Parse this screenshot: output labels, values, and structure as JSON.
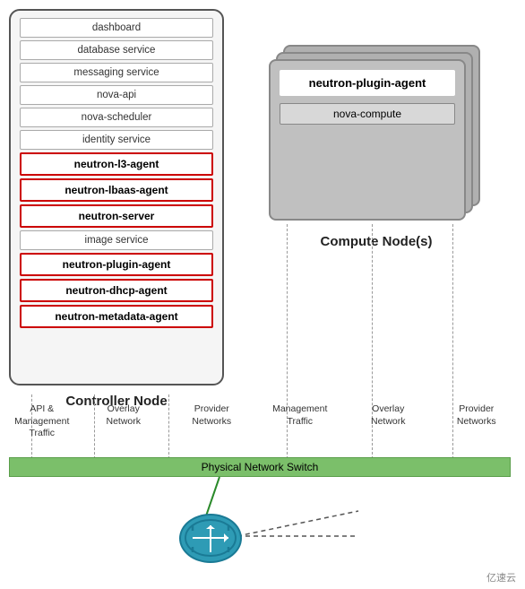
{
  "controller": {
    "label": "Controller Node",
    "services": [
      {
        "id": "dashboard",
        "text": "dashboard",
        "style": "normal"
      },
      {
        "id": "database-service",
        "text": "database service",
        "style": "normal"
      },
      {
        "id": "messaging-service",
        "text": "messaging service",
        "style": "normal"
      },
      {
        "id": "nova-api",
        "text": "nova-api",
        "style": "normal"
      },
      {
        "id": "nova-scheduler",
        "text": "nova-scheduler",
        "style": "normal"
      },
      {
        "id": "identity-service",
        "text": "identity service",
        "style": "normal"
      },
      {
        "id": "neutron-l3-agent",
        "text": "neutron-l3-agent",
        "style": "red"
      },
      {
        "id": "neutron-lbaas-agent",
        "text": "neutron-lbaas-agent",
        "style": "red"
      },
      {
        "id": "neutron-server",
        "text": "neutron-server",
        "style": "red"
      },
      {
        "id": "image-service",
        "text": "image service",
        "style": "normal"
      },
      {
        "id": "neutron-plugin-agent",
        "text": "neutron-plugin-agent",
        "style": "red"
      },
      {
        "id": "neutron-dhcp-agent",
        "text": "neutron-dhcp-agent",
        "style": "red"
      },
      {
        "id": "neutron-metadata-agent",
        "text": "neutron-metadata-agent",
        "style": "red"
      }
    ]
  },
  "compute": {
    "label": "Compute Node(s)",
    "neutron_plugin": "neutron-plugin-agent",
    "nova_compute": "nova-compute"
  },
  "network_labels": [
    {
      "id": "api-mgmt",
      "text": "API &\nManagement\nTraffic"
    },
    {
      "id": "overlay-net-ctrl",
      "text": "Overlay\nNetwork"
    },
    {
      "id": "provider-net-ctrl",
      "text": "Provider\nNetworks"
    },
    {
      "id": "mgmt-traffic",
      "text": "Management\nTraffic"
    },
    {
      "id": "overlay-net-comp",
      "text": "Overlay\nNetwork"
    },
    {
      "id": "provider-net-comp",
      "text": "Provider\nNetworks"
    }
  ],
  "switch": {
    "label": "Physical Network Switch"
  },
  "watermark": "亿速云"
}
